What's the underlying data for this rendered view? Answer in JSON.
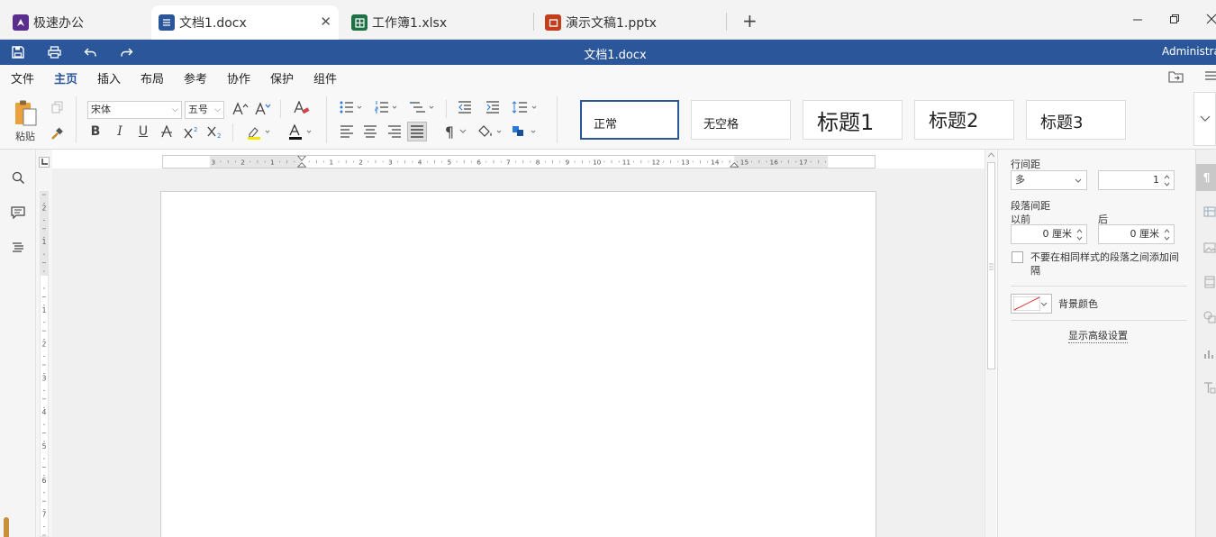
{
  "tabs": [
    {
      "label": "极速办公",
      "icon": "app-logo-icon"
    },
    {
      "label": "文档1.docx",
      "icon": "doc-icon"
    },
    {
      "label": "工作簿1.xlsx",
      "icon": "sheet-icon"
    },
    {
      "label": "演示文稿1.pptx",
      "icon": "slides-icon"
    }
  ],
  "titlebar": {
    "doc_title": "文档1.docx",
    "user": "Administrator"
  },
  "menu": [
    "文件",
    "主页",
    "插入",
    "布局",
    "参考",
    "协作",
    "保护",
    "组件"
  ],
  "menu_active": "主页",
  "ribbon": {
    "paste_label": "粘贴",
    "font_name": "宋体",
    "font_size": "五号",
    "bold": "B",
    "italic": "I",
    "underline": "U",
    "paragraph_mark": "¶"
  },
  "styles": [
    "正常",
    "无空格",
    "标题1",
    "标题2",
    "标题3"
  ],
  "ruler_marks": [
    "3",
    "2",
    "1",
    "1",
    "2",
    "3",
    "4",
    "5",
    "6",
    "7",
    "8",
    "9",
    "10",
    "11",
    "12",
    "13",
    "14",
    "15",
    "16",
    "17"
  ],
  "vruler_marks": [
    "2",
    "1",
    "1",
    "2",
    "3",
    "4",
    "5",
    "6",
    "7"
  ],
  "panel": {
    "line_spacing_label": "行间距",
    "line_spacing_type": "多",
    "line_spacing_value": "1",
    "para_spacing_label": "段落间距",
    "before_label": "以前",
    "after_label": "后",
    "before_value": "0 厘米",
    "after_value": "0 厘米",
    "no_space_checkbox": "不要在相同样式的段落之间添加间隔",
    "bg_color_label": "背景颜色",
    "advanced_link": "显示高级设置"
  },
  "colors": {
    "accent": "#2b579a",
    "doc": "#2b579a",
    "sheet": "#1e7145",
    "slides": "#c43e1c",
    "logo": "#5b2d8c"
  }
}
